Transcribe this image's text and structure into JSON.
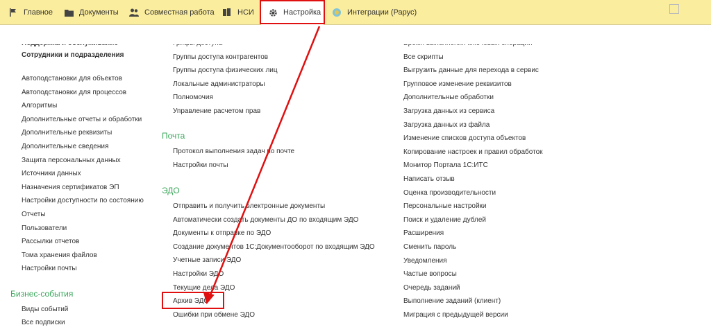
{
  "topbar": {
    "tabs": [
      {
        "label": "Главное",
        "icon": "flag-icon"
      },
      {
        "label": "Документы",
        "icon": "folder-icon"
      },
      {
        "label": "Совместная работа",
        "icon": "users-icon"
      },
      {
        "label": "НСИ",
        "icon": "book-icon"
      },
      {
        "label": "Настройка",
        "icon": "gear-icon"
      },
      {
        "label": "Интеграции (Рарус)",
        "icon": "integration-icon"
      }
    ],
    "active_tab": "Настройка",
    "accent_color": "#fbed9e",
    "highlight_color": "#e01010"
  },
  "col1": {
    "items_top": [
      "Поддержка и обслуживание",
      "Сотрудники и подразделения"
    ],
    "items": [
      "Автоподстановки для объектов",
      "Автоподстановки для процессов",
      "Алгоритмы",
      "Дополнительные отчеты и обработки",
      "Дополнительные реквизиты",
      "Дополнительные сведения",
      "Защита персональных данных",
      "Источники данных",
      "Назначения сертификатов ЭП",
      "Настройки доступности по состоянию",
      "Отчеты",
      "Пользователи",
      "Рассылки отчетов",
      "Тома хранения файлов",
      "Настройки почты"
    ],
    "group2_title": "Бизнес-события",
    "group2_items": [
      "Виды событий",
      "Все подписки"
    ]
  },
  "col2": {
    "items_top": [
      "Грифы доступа",
      "Группы доступа контрагентов",
      "Группы доступа физических лиц",
      "Локальные администраторы",
      "Полномочия",
      "Управление расчетом прав"
    ],
    "group_mail_title": "Почта",
    "group_mail_items": [
      "Протокол выполнения задач по почте",
      "Настройки почты"
    ],
    "group_edo_title": "ЭДО",
    "group_edo_items": [
      "Отправить и получить электронные документы",
      "Автоматически создать документы ДО по входящим ЭДО",
      "Документы к отправке по ЭДО",
      "Создание документов 1С:Документооборот по входящим ЭДО",
      "Учетные записи ЭДО",
      "Настройки ЭДО",
      "Текущие дела ЭДО",
      "Архив ЭДО",
      "Ошибки при обмене ЭДО"
    ],
    "highlighted_item": "Архив ЭДО"
  },
  "col3": {
    "items": [
      "Время выполнения ключевых операций",
      "Все скрипты",
      "Выгрузить данные для перехода в сервис",
      "Групповое изменение реквизитов",
      "Дополнительные обработки",
      "Загрузка данных из сервиса",
      "Загрузка данных из файла",
      "Изменение списков доступа объектов",
      "Копирование настроек и правил обработок",
      "Монитор Портала 1С:ИТС",
      "Написать отзыв",
      "Оценка производительности",
      "Персональные настройки",
      "Поиск и удаление дублей",
      "Расширения",
      "Сменить пароль",
      "Уведомления",
      "Частые вопросы",
      "Очередь заданий",
      "Выполнение заданий (клиент)",
      "Миграция с предыдущей версии"
    ]
  }
}
